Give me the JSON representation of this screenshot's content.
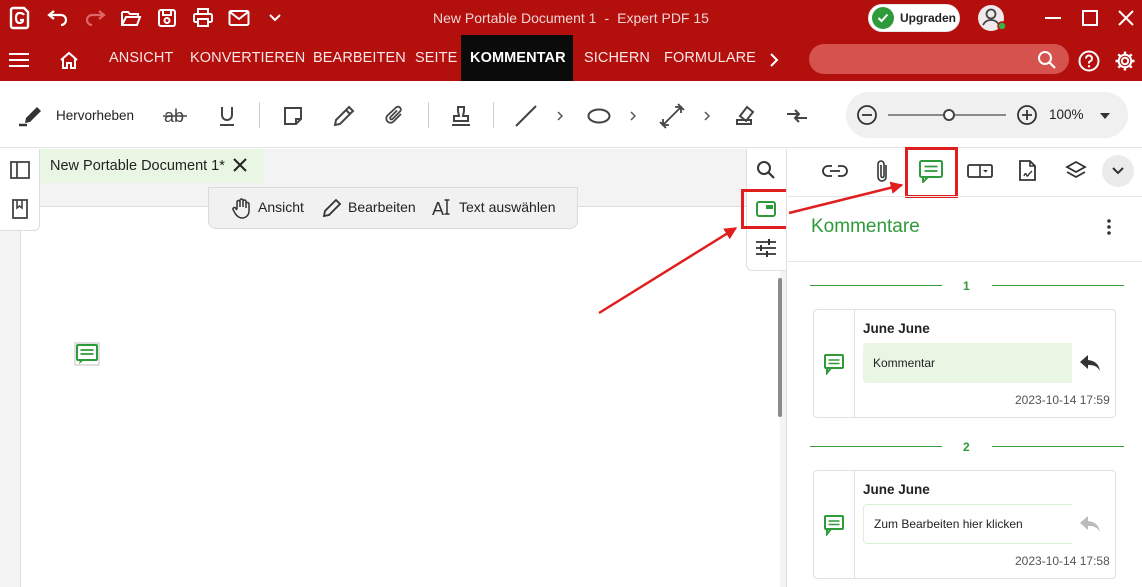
{
  "window": {
    "title": "New Portable Document 1",
    "title_sep": "-",
    "app_name": "Expert PDF 15",
    "upgrade_label": "Upgraden"
  },
  "menu": {
    "items": [
      "ANSICHT",
      "KONVERTIEREN",
      "BEARBEITEN",
      "SEITE",
      "KOMMENTAR",
      "SICHERN",
      "FORMULARE"
    ],
    "active": "KOMMENTAR"
  },
  "toolbar": {
    "highlight_label": "Hervorheben",
    "zoom_value": "100%"
  },
  "document": {
    "tab_title": "New Portable Document 1*",
    "floating": {
      "view_label": "Ansicht",
      "edit_label": "Bearbeiten",
      "select_text_label": "Text auswählen"
    }
  },
  "comments_panel": {
    "title": "Kommentare",
    "groups": [
      {
        "page": "1",
        "author": "June June",
        "text": "Kommentar",
        "date": "2023-10-14 17:59"
      },
      {
        "page": "2",
        "author": "June June",
        "text": "Zum Bearbeiten hier klicken",
        "date": "2023-10-14 17:58"
      }
    ]
  },
  "colors": {
    "brand_red": "#b30f0d",
    "accent_green": "#2f9a3a",
    "highlight_red": "#e01e1e"
  }
}
